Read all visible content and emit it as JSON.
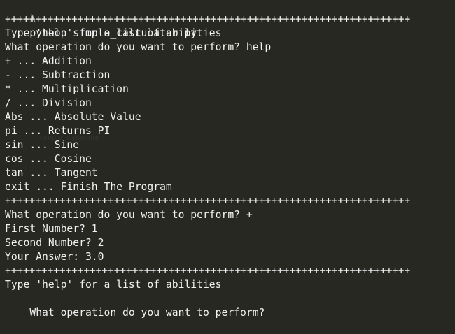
{
  "terminal": {
    "prompt_symbol": "λ",
    "command": "python simple_calculator.py",
    "separator": "+++++++++++++++++++++++++++++++++++++++++++++++++++++++++++++++++++",
    "block1": {
      "help_hint": "Type 'help' for a list of abilities",
      "question": "What operation do you want to perform? help"
    },
    "help_items": [
      "+ ... Addition",
      "- ... Subtraction",
      "* ... Multiplication",
      "/ ... Division",
      "Abs ... Absolute Value",
      "pi ... Returns PI",
      "sin ... Sine",
      "cos ... Cosine",
      "tan ... Tangent",
      "exit ... Finish The Program"
    ],
    "block2": {
      "question": "What operation do you want to perform? +",
      "first": "First Number? 1",
      "second": "Second Number? 2",
      "answer": "Your Answer: 3.0"
    },
    "block3": {
      "help_hint": "Type 'help' for a list of abilities",
      "question": "What operation do you want to perform?"
    },
    "ghost_text": "simple_calculator"
  }
}
